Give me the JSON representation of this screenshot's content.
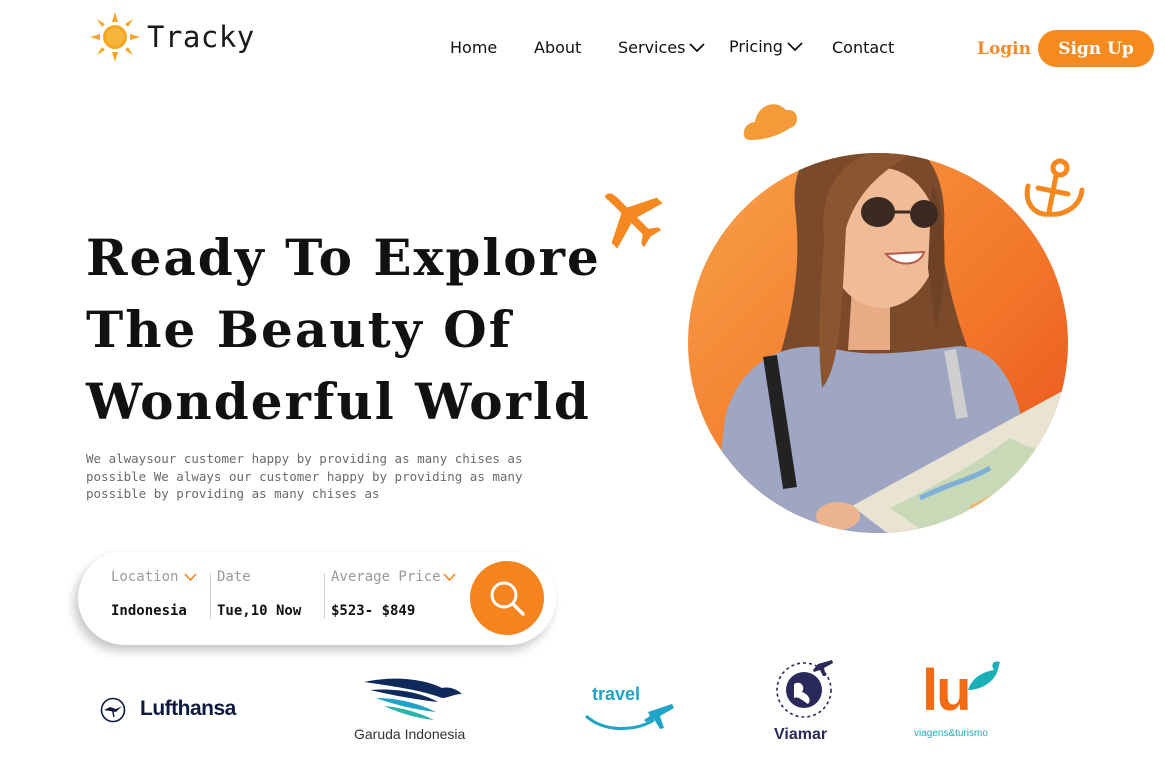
{
  "brand": {
    "name": "Tracky",
    "color": "#F58A1F"
  },
  "nav": {
    "items": [
      {
        "label": "Home",
        "dropdown": false
      },
      {
        "label": "About",
        "dropdown": false
      },
      {
        "label": "Services",
        "dropdown": true
      },
      {
        "label": "Pricing",
        "dropdown": true
      },
      {
        "label": "Contact",
        "dropdown": false
      }
    ]
  },
  "auth": {
    "login_label": "Login",
    "signup_label": "Sign Up"
  },
  "hero": {
    "title_lines": [
      "Ready To Explore",
      "The Beauty Of",
      "Wonderful World"
    ],
    "description": "We alwaysour customer happy by providing as many chises as possible We always our customer happy by providing as many possible by providing as many chises as"
  },
  "search": {
    "location": {
      "label": "Location",
      "value": "Indonesia"
    },
    "date": {
      "label": "Date",
      "value": "Tue,10 Now"
    },
    "price": {
      "label": "Average Price",
      "value": "$523- $849"
    },
    "button_icon": "search-icon"
  },
  "icons": {
    "cloud": "cloud-icon",
    "airplane": "airplane-icon",
    "anchor": "anchor-icon"
  },
  "partners": [
    {
      "name": "Lufthansa",
      "icon": "crane-icon"
    },
    {
      "name": "Garuda Indonesia",
      "icon": "garuda-bird-icon"
    },
    {
      "name": "travel",
      "icon": "airplane-icon"
    },
    {
      "name": "Viamar",
      "icon": "globe-icon"
    },
    {
      "name": "lu",
      "caption": "viagens&turismo",
      "icon": "bird-icon"
    }
  ],
  "colors": {
    "accent": "#F58A1F",
    "accent_dark": "#EA5A1C",
    "navy": "#0E1A3D",
    "teal": "#1FA3C7",
    "lu_orange": "#F26B12",
    "lu_teal": "#1BAFB8"
  }
}
